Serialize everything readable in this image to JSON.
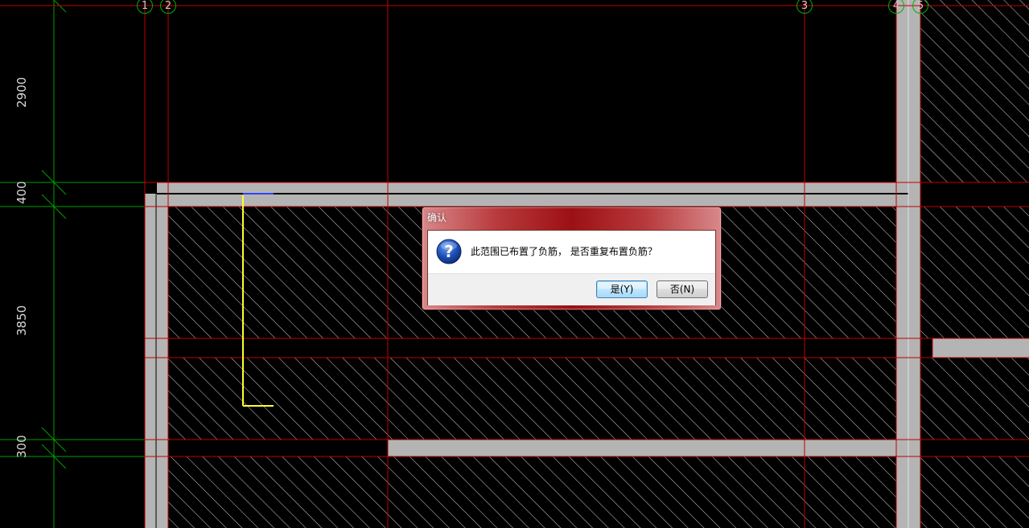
{
  "cad": {
    "dimensions": [
      "2900",
      "400",
      "3850",
      "300"
    ],
    "axis_bubbles": [
      "1",
      "2",
      "3",
      "4",
      "5"
    ],
    "colors": {
      "background": "#000000",
      "axis_red": "#c00000",
      "dim_green": "#00a000",
      "slab_gray": "#b4b4b4",
      "hatch_white": "#d0d0d0",
      "rebar_yellow": "#ffff30",
      "rebar_blue": "#3040ff"
    }
  },
  "dialog": {
    "title": "确认",
    "message": "此范围已布置了负筋， 是否重复布置负筋？",
    "icon": "question-icon",
    "yes_label": "是(Y)",
    "no_label": "否(N)"
  }
}
